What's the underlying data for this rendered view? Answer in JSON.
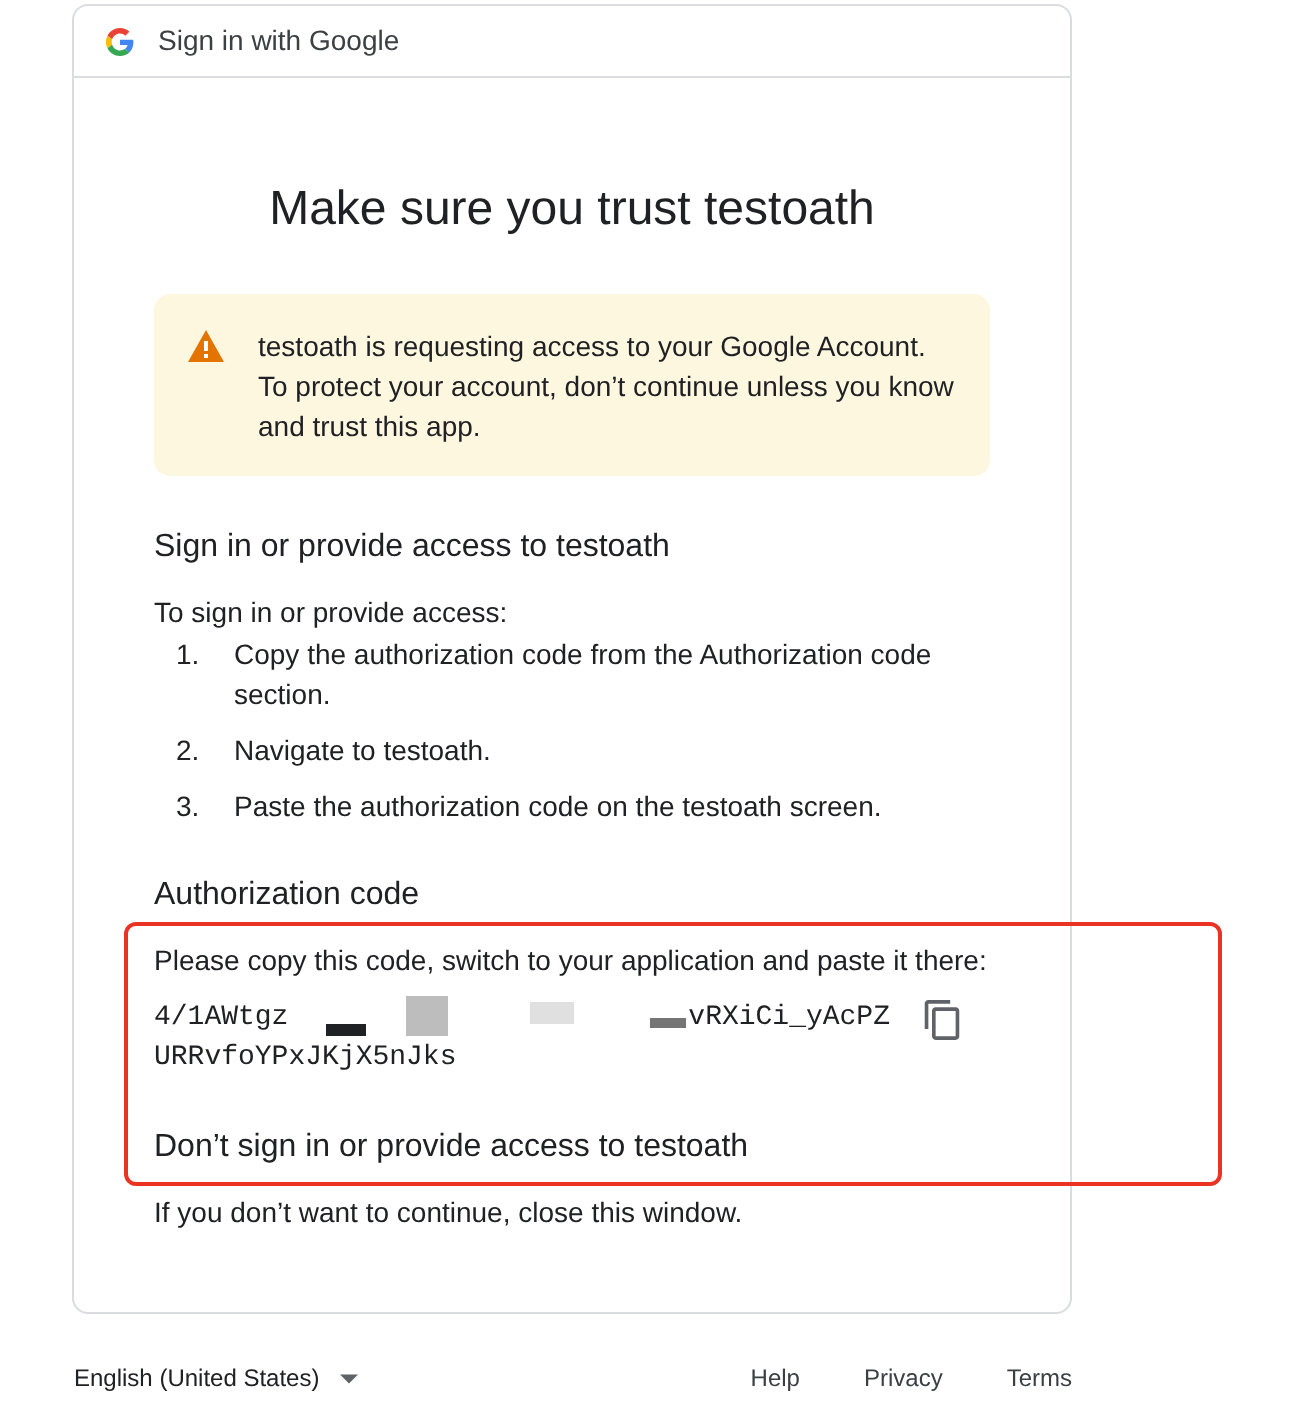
{
  "header": {
    "title": "Sign in with Google"
  },
  "heading": "Make sure you trust testoath",
  "warning": {
    "text": "testoath is requesting access to your Google Account. To protect your account, don’t continue unless you know and trust this app."
  },
  "sections": [
    {
      "heading": "Sign in or provide access to testoath",
      "intro": "To sign in or provide access:",
      "steps": [
        {
          "number": "1.",
          "text": "Copy the authorization code from the Authorization code section."
        },
        {
          "number": "2.",
          "text": "Navigate to testoath."
        },
        {
          "number": "3.",
          "text": "Paste the authorization code on the testoath screen."
        }
      ]
    },
    {
      "heading": "Authorization code",
      "intro": "Please copy this code, switch to your application and paste it there:",
      "code_lines": [
        [
          {
            "kind": "text",
            "text": "4/1AWtgz"
          },
          {
            "kind": "redacted"
          },
          {
            "kind": "text",
            "text": "vRXiCi_yAcPZ"
          }
        ],
        [
          {
            "kind": "text",
            "text": "URRvfoYPxJKjX5nJks"
          }
        ]
      ]
    },
    {
      "heading": "Don’t sign in or provide access to testoath",
      "intro": "If you don’t want to continue, close this window."
    }
  ],
  "footer": {
    "language": "English (United States)",
    "links": [
      "Help",
      "Privacy",
      "Terms"
    ]
  }
}
